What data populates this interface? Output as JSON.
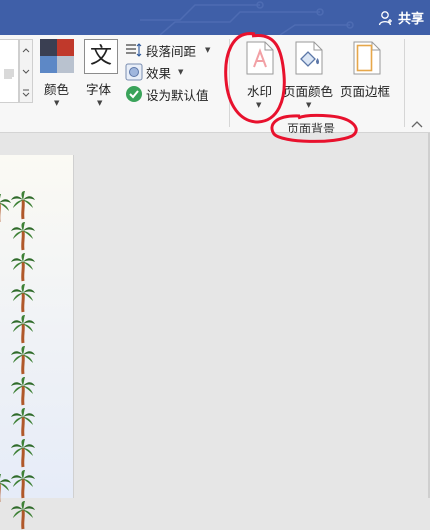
{
  "titlebar": {
    "share_label": "共享",
    "share_icon": "person-add-icon",
    "color": "#3f5fa8"
  },
  "ribbon": {
    "colors_label": "颜色",
    "fonts_label": "字体",
    "fonts_glyph": "文",
    "paragraph_spacing_label": "段落间距",
    "effects_label": "效果",
    "set_default_label": "设为默认值",
    "watermark_label": "水印",
    "page_color_label": "页面颜色",
    "page_borders_label": "页面边框",
    "page_background_group": "页面背景"
  },
  "annotation_color": "#e8112d"
}
